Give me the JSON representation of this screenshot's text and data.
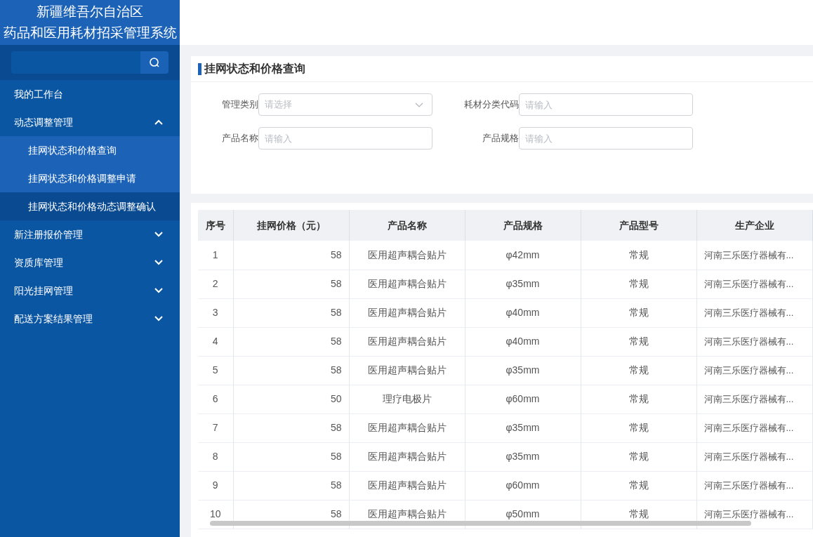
{
  "sidebar": {
    "title_lines": [
      "新疆维吾尔自治区",
      "药品和医用耗材招采管理系统"
    ],
    "menu": [
      {
        "label": "我的工作台",
        "kind": "link"
      },
      {
        "label": "动态调整管理",
        "kind": "group",
        "expanded": true,
        "children": [
          {
            "label": "挂网状态和价格查询",
            "selected": false
          },
          {
            "label": "挂网状态和价格调整申请",
            "selected": false
          },
          {
            "label": "挂网状态和价格动态调整确认",
            "selected": true
          }
        ]
      },
      {
        "label": "新注册报价管理",
        "kind": "group",
        "expanded": false
      },
      {
        "label": "资质库管理",
        "kind": "group",
        "expanded": false
      },
      {
        "label": "阳光挂网管理",
        "kind": "group",
        "expanded": false
      },
      {
        "label": "配送方案结果管理",
        "kind": "group",
        "expanded": false
      }
    ]
  },
  "panel": {
    "title": "挂网状态和价格查询",
    "filters": [
      {
        "label": "管理类别",
        "kind": "select",
        "placeholder": "请选择"
      },
      {
        "label": "耗材分类代码",
        "kind": "input",
        "placeholder": "请输入"
      },
      {
        "label": "产品名称",
        "kind": "input",
        "placeholder": "请输入"
      },
      {
        "label": "产品规格",
        "kind": "input",
        "placeholder": "请输入"
      }
    ]
  },
  "table": {
    "columns": [
      "序号",
      "挂网价格（元）",
      "产品名称",
      "产品规格",
      "产品型号",
      "生产企业"
    ],
    "rows": [
      [
        "1",
        "58",
        "医用超声耦合贴片",
        "φ42mm",
        "常规",
        "河南三乐医疗器械有..."
      ],
      [
        "2",
        "58",
        "医用超声耦合贴片",
        "φ35mm",
        "常规",
        "河南三乐医疗器械有..."
      ],
      [
        "3",
        "58",
        "医用超声耦合贴片",
        "φ40mm",
        "常规",
        "河南三乐医疗器械有..."
      ],
      [
        "4",
        "58",
        "医用超声耦合贴片",
        "φ40mm",
        "常规",
        "河南三乐医疗器械有..."
      ],
      [
        "5",
        "58",
        "医用超声耦合贴片",
        "φ35mm",
        "常规",
        "河南三乐医疗器械有..."
      ],
      [
        "6",
        "50",
        "理疗电极片",
        "φ60mm",
        "常规",
        "河南三乐医疗器械有..."
      ],
      [
        "7",
        "58",
        "医用超声耦合贴片",
        "φ35mm",
        "常规",
        "河南三乐医疗器械有..."
      ],
      [
        "8",
        "58",
        "医用超声耦合贴片",
        "φ35mm",
        "常规",
        "河南三乐医疗器械有..."
      ],
      [
        "9",
        "58",
        "医用超声耦合贴片",
        "φ60mm",
        "常规",
        "河南三乐医疗器械有..."
      ],
      [
        "10",
        "58",
        "医用超声耦合贴片",
        "φ50mm",
        "常规",
        "河南三乐医疗器械有..."
      ]
    ]
  }
}
